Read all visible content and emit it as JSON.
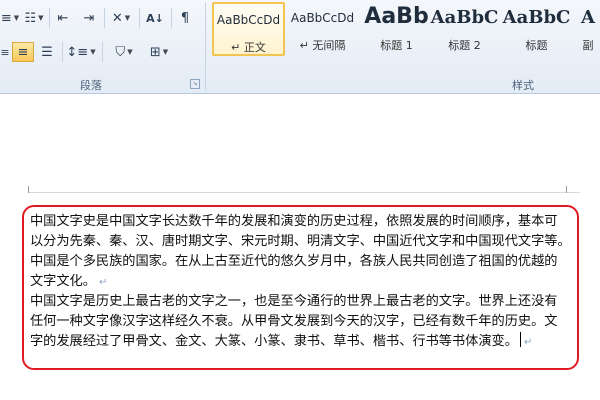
{
  "ribbon": {
    "groups": {
      "paragraph": "段落",
      "styles": "样式"
    },
    "styles": [
      {
        "sample": "AaBbCcDd",
        "name": "↵ 正文"
      },
      {
        "sample": "AaBbCcDd",
        "name": "↵ 无间隔"
      },
      {
        "sample": "AaBb",
        "name": "标题 1"
      },
      {
        "sample": "AaBbC",
        "name": "标题 2"
      },
      {
        "sample": "AaBbC",
        "name": "标题"
      },
      {
        "sample": "A",
        "name": "副"
      }
    ],
    "selected_style": 0
  },
  "document": {
    "paragraph1": [
      "中国文字史是中国文字长达数千年的发展和演变的历史过程，依照发展的时间顺序，基本可",
      "以分为先秦、秦、汉、唐时期文字、宋元时期、明清文字、中国近代文字和中国现代文字等。",
      "中国是个多民族的国家。在从上古至近代的悠久岁月中，各族人民共同创造了祖国的优越的",
      "文字文化。"
    ],
    "paragraph2": [
      "中国文字是历史上最古老的文字之一，也是至今通行的世界上最古老的文字。世界上还没有",
      "任何一种文字像汉字这样经久不衰。从甲骨文发展到今天的汉字，已经有数千年的历史。文",
      "字的发展经过了甲骨文、金文、大篆、小篆、隶书、草书、楷书、行书等书体演变。"
    ],
    "paragraph_mark": "↵"
  },
  "colors": {
    "highlight": "#e11b22",
    "ribbon_selected": "#f2c452"
  }
}
